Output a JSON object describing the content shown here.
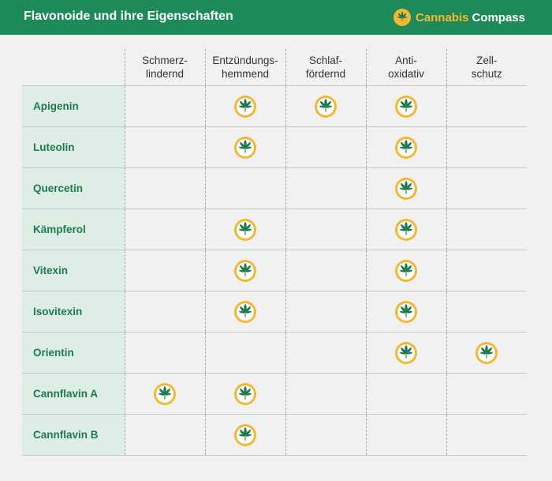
{
  "header": {
    "title": "Flavonoide und ihre Eigenschaften",
    "brand_word1": "Cannabis",
    "brand_word2": "Compass",
    "brand_icon": "cannabis-leaf-icon"
  },
  "colors": {
    "header_bg": "#1e8a5a",
    "accent_yellow": "#f4b731",
    "leaf_green": "#1e7b4f",
    "row_label_bg": "#deede5",
    "page_bg": "#f1f1f1"
  },
  "table": {
    "columns": [
      {
        "line1": "Schmerz-",
        "line2": "lindernd"
      },
      {
        "line1": "Entzündungs-",
        "line2": "hemmend"
      },
      {
        "line1": "Schlaf-",
        "line2": "fördernd"
      },
      {
        "line1": "Anti-",
        "line2": "oxidativ"
      },
      {
        "line1": "Zell-",
        "line2": "schutz"
      }
    ],
    "rows": [
      {
        "name": "Apigenin",
        "marks": [
          false,
          true,
          true,
          true,
          false
        ]
      },
      {
        "name": "Luteolin",
        "marks": [
          false,
          true,
          false,
          true,
          false
        ]
      },
      {
        "name": "Quercetin",
        "marks": [
          false,
          false,
          false,
          true,
          false
        ]
      },
      {
        "name": "Kämpferol",
        "marks": [
          false,
          true,
          false,
          true,
          false
        ]
      },
      {
        "name": "Vitexin",
        "marks": [
          false,
          true,
          false,
          true,
          false
        ]
      },
      {
        "name": "Isovitexin",
        "marks": [
          false,
          true,
          false,
          true,
          false
        ]
      },
      {
        "name": "Orientin",
        "marks": [
          false,
          false,
          false,
          true,
          true
        ]
      },
      {
        "name": "Cannflavin A",
        "marks": [
          true,
          true,
          false,
          false,
          false
        ]
      },
      {
        "name": "Cannflavin B",
        "marks": [
          false,
          true,
          false,
          false,
          false
        ]
      }
    ],
    "mark_icon": "cannabis-leaf-badge-icon"
  }
}
